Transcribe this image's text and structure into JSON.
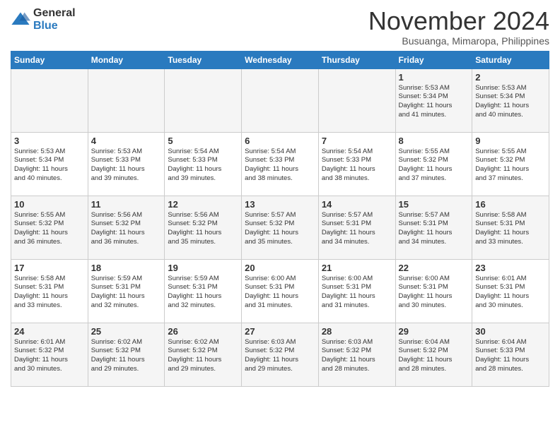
{
  "header": {
    "logo_general": "General",
    "logo_blue": "Blue",
    "month": "November 2024",
    "location": "Busuanga, Mimaropa, Philippines"
  },
  "weekdays": [
    "Sunday",
    "Monday",
    "Tuesday",
    "Wednesday",
    "Thursday",
    "Friday",
    "Saturday"
  ],
  "weeks": [
    [
      {
        "day": "",
        "info": ""
      },
      {
        "day": "",
        "info": ""
      },
      {
        "day": "",
        "info": ""
      },
      {
        "day": "",
        "info": ""
      },
      {
        "day": "",
        "info": ""
      },
      {
        "day": "1",
        "info": "Sunrise: 5:53 AM\nSunset: 5:34 PM\nDaylight: 11 hours\nand 41 minutes."
      },
      {
        "day": "2",
        "info": "Sunrise: 5:53 AM\nSunset: 5:34 PM\nDaylight: 11 hours\nand 40 minutes."
      }
    ],
    [
      {
        "day": "3",
        "info": "Sunrise: 5:53 AM\nSunset: 5:34 PM\nDaylight: 11 hours\nand 40 minutes."
      },
      {
        "day": "4",
        "info": "Sunrise: 5:53 AM\nSunset: 5:33 PM\nDaylight: 11 hours\nand 39 minutes."
      },
      {
        "day": "5",
        "info": "Sunrise: 5:54 AM\nSunset: 5:33 PM\nDaylight: 11 hours\nand 39 minutes."
      },
      {
        "day": "6",
        "info": "Sunrise: 5:54 AM\nSunset: 5:33 PM\nDaylight: 11 hours\nand 38 minutes."
      },
      {
        "day": "7",
        "info": "Sunrise: 5:54 AM\nSunset: 5:33 PM\nDaylight: 11 hours\nand 38 minutes."
      },
      {
        "day": "8",
        "info": "Sunrise: 5:55 AM\nSunset: 5:32 PM\nDaylight: 11 hours\nand 37 minutes."
      },
      {
        "day": "9",
        "info": "Sunrise: 5:55 AM\nSunset: 5:32 PM\nDaylight: 11 hours\nand 37 minutes."
      }
    ],
    [
      {
        "day": "10",
        "info": "Sunrise: 5:55 AM\nSunset: 5:32 PM\nDaylight: 11 hours\nand 36 minutes."
      },
      {
        "day": "11",
        "info": "Sunrise: 5:56 AM\nSunset: 5:32 PM\nDaylight: 11 hours\nand 36 minutes."
      },
      {
        "day": "12",
        "info": "Sunrise: 5:56 AM\nSunset: 5:32 PM\nDaylight: 11 hours\nand 35 minutes."
      },
      {
        "day": "13",
        "info": "Sunrise: 5:57 AM\nSunset: 5:32 PM\nDaylight: 11 hours\nand 35 minutes."
      },
      {
        "day": "14",
        "info": "Sunrise: 5:57 AM\nSunset: 5:31 PM\nDaylight: 11 hours\nand 34 minutes."
      },
      {
        "day": "15",
        "info": "Sunrise: 5:57 AM\nSunset: 5:31 PM\nDaylight: 11 hours\nand 34 minutes."
      },
      {
        "day": "16",
        "info": "Sunrise: 5:58 AM\nSunset: 5:31 PM\nDaylight: 11 hours\nand 33 minutes."
      }
    ],
    [
      {
        "day": "17",
        "info": "Sunrise: 5:58 AM\nSunset: 5:31 PM\nDaylight: 11 hours\nand 33 minutes."
      },
      {
        "day": "18",
        "info": "Sunrise: 5:59 AM\nSunset: 5:31 PM\nDaylight: 11 hours\nand 32 minutes."
      },
      {
        "day": "19",
        "info": "Sunrise: 5:59 AM\nSunset: 5:31 PM\nDaylight: 11 hours\nand 32 minutes."
      },
      {
        "day": "20",
        "info": "Sunrise: 6:00 AM\nSunset: 5:31 PM\nDaylight: 11 hours\nand 31 minutes."
      },
      {
        "day": "21",
        "info": "Sunrise: 6:00 AM\nSunset: 5:31 PM\nDaylight: 11 hours\nand 31 minutes."
      },
      {
        "day": "22",
        "info": "Sunrise: 6:00 AM\nSunset: 5:31 PM\nDaylight: 11 hours\nand 30 minutes."
      },
      {
        "day": "23",
        "info": "Sunrise: 6:01 AM\nSunset: 5:31 PM\nDaylight: 11 hours\nand 30 minutes."
      }
    ],
    [
      {
        "day": "24",
        "info": "Sunrise: 6:01 AM\nSunset: 5:32 PM\nDaylight: 11 hours\nand 30 minutes."
      },
      {
        "day": "25",
        "info": "Sunrise: 6:02 AM\nSunset: 5:32 PM\nDaylight: 11 hours\nand 29 minutes."
      },
      {
        "day": "26",
        "info": "Sunrise: 6:02 AM\nSunset: 5:32 PM\nDaylight: 11 hours\nand 29 minutes."
      },
      {
        "day": "27",
        "info": "Sunrise: 6:03 AM\nSunset: 5:32 PM\nDaylight: 11 hours\nand 29 minutes."
      },
      {
        "day": "28",
        "info": "Sunrise: 6:03 AM\nSunset: 5:32 PM\nDaylight: 11 hours\nand 28 minutes."
      },
      {
        "day": "29",
        "info": "Sunrise: 6:04 AM\nSunset: 5:32 PM\nDaylight: 11 hours\nand 28 minutes."
      },
      {
        "day": "30",
        "info": "Sunrise: 6:04 AM\nSunset: 5:33 PM\nDaylight: 11 hours\nand 28 minutes."
      }
    ]
  ]
}
